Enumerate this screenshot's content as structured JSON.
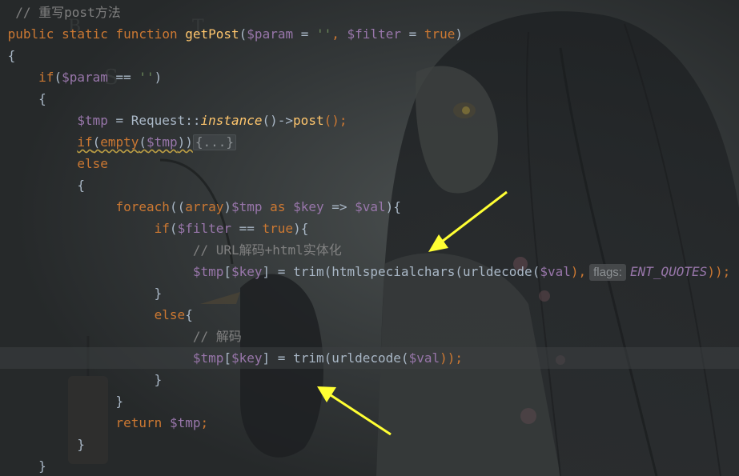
{
  "code": {
    "line1_comment": "// 重写post方法",
    "line2": {
      "kw_public": "public",
      "kw_static": "static",
      "kw_function": "function",
      "fn_name": "getPost",
      "open_paren": "(",
      "param": "$param",
      "eq1": " = ",
      "empty_str": "''",
      "comma": ", ",
      "filter": "$filter",
      "eq2": " = ",
      "true_kw": "true",
      "close_paren": ")"
    },
    "line3": "{",
    "line4": {
      "kw_if": "if",
      "open": "(",
      "param": "$param",
      "op": " == ",
      "str": "''",
      "close": ")"
    },
    "line5": "{",
    "line6": {
      "tmp": "$tmp",
      "assign": " = Request::",
      "instance": "instance",
      "arrow": "()->",
      "post": "post",
      "end": "();"
    },
    "line7": {
      "kw_if": "if",
      "open": "(",
      "empty": "empty",
      "open2": "(",
      "tmp": "$tmp",
      "close": "))",
      "fold": "{...}"
    },
    "line8": "else",
    "line9": "{",
    "line10": {
      "kw_foreach": "foreach",
      "open": "((",
      "kw_array": "array",
      "close_cast": ")",
      "tmp": "$tmp",
      "kw_as": " as ",
      "key": "$key",
      "arrow": " => ",
      "val": "$val",
      "end": "){"
    },
    "line11": {
      "kw_if": "if",
      "open": "(",
      "filter": "$filter",
      "op": " == ",
      "true_kw": "true",
      "end": "){"
    },
    "line12_comment": "// URL解码+html实体化",
    "line13": {
      "tmp": "$tmp",
      "open_br": "[",
      "key": "$key",
      "close_br": "]",
      "assign": " = trim(htmlspecialchars(urldecode(",
      "val": "$val",
      "close": "),",
      "hint_label": "flags:",
      "const": "ENT_QUOTES",
      "end": "));"
    },
    "line14": "}",
    "line15": {
      "kw_else": "else",
      "brace": "{"
    },
    "line16_comment": "// 解码",
    "line17": {
      "tmp": "$tmp",
      "open_br": "[",
      "key": "$key",
      "close_br": "]",
      "assign": " = trim(urldecode(",
      "val": "$val",
      "end": "));"
    },
    "line18": "}",
    "line19": "}",
    "line20": {
      "kw_return": "return",
      "tmp": "$tmp",
      "end": ";"
    },
    "line21": "}",
    "line22": "}"
  },
  "colors": {
    "keyword": "#cc7832",
    "function": "#ffc66d",
    "variable": "#9876aa",
    "string": "#6a8759",
    "comment": "#808080",
    "text": "#a9b7c6",
    "arrow": "#ffff33"
  }
}
